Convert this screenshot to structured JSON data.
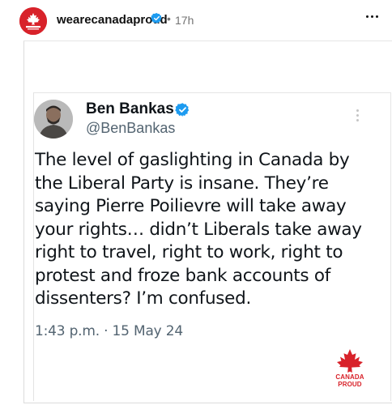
{
  "post": {
    "account": "wearecanadaproud",
    "separator": "•",
    "time_ago": "17h",
    "verified": true
  },
  "tweet": {
    "author": "Ben Bankas",
    "handle": "@BenBankas",
    "text": "The level of gaslighting in Canada by the Liberal Party is insane. They’re saying Pierre Poilievre will take away your rights… didn’t Liberals take away right to travel, right to work, right to protest and froze bank accounts of dissenters? I’m confused.",
    "date": "1:43 p.m. · 15 May 24",
    "verified": true
  },
  "brand": {
    "label": "CANADA PROUD",
    "color": "#d8222a"
  },
  "colors": {
    "verified": "#1d9bf0",
    "muted": "#737373"
  },
  "icons": [
    "maple-leaf-icon",
    "verified-badge-icon",
    "more-options-icon"
  ]
}
